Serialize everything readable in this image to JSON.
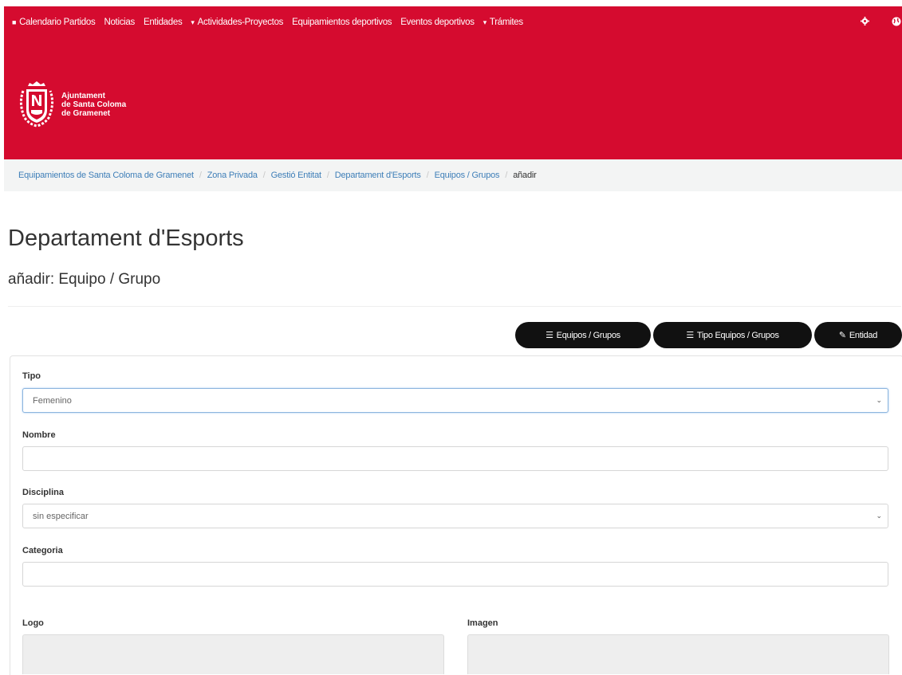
{
  "nav": {
    "items": [
      {
        "glyph": "■",
        "label": "Calendario Partidos"
      },
      {
        "glyph": "",
        "label": "Noticias"
      },
      {
        "glyph": "",
        "label": "Entidades"
      },
      {
        "glyph": "▾",
        "label": "Actividades-Proyectos"
      },
      {
        "glyph": "",
        "label": "Equipamientos deportivos"
      },
      {
        "glyph": "",
        "label": "Eventos deportivos"
      },
      {
        "glyph": "▾",
        "label": "Trámites"
      }
    ],
    "settings_icon": "gear-icon",
    "language_icon": "globe-icon"
  },
  "logo": {
    "line1": "Ajuntament",
    "line2": "de Santa Coloma",
    "line3": "de Gramenet"
  },
  "breadcrumb": {
    "items": [
      "Equipamientos de Santa Coloma de Gramenet",
      "Zona Privada",
      "Gestió Entitat",
      "Departament d'Esports",
      "Equipos / Grupos"
    ],
    "active": "añadir"
  },
  "page": {
    "title": "Departament d'Esports",
    "subtitle": "añadir: Equipo / Grupo"
  },
  "buttons": {
    "equipos": "Equipos / Grupos",
    "tipo_equipos": "Tipo Equipos / Grupos",
    "entidad": "Entidad"
  },
  "form": {
    "tipo": {
      "label": "Tipo",
      "value": "Femenino"
    },
    "nombre": {
      "label": "Nombre",
      "value": ""
    },
    "disciplina": {
      "label": "Disciplina",
      "value": "sin especificar"
    },
    "categoria": {
      "label": "Categoria",
      "value": ""
    },
    "logo": {
      "label": "Logo"
    },
    "imagen": {
      "label": "Imagen"
    }
  },
  "colors": {
    "header_bg": "#d50b2f",
    "link": "#3f7fb8",
    "button_bg": "#111111"
  }
}
